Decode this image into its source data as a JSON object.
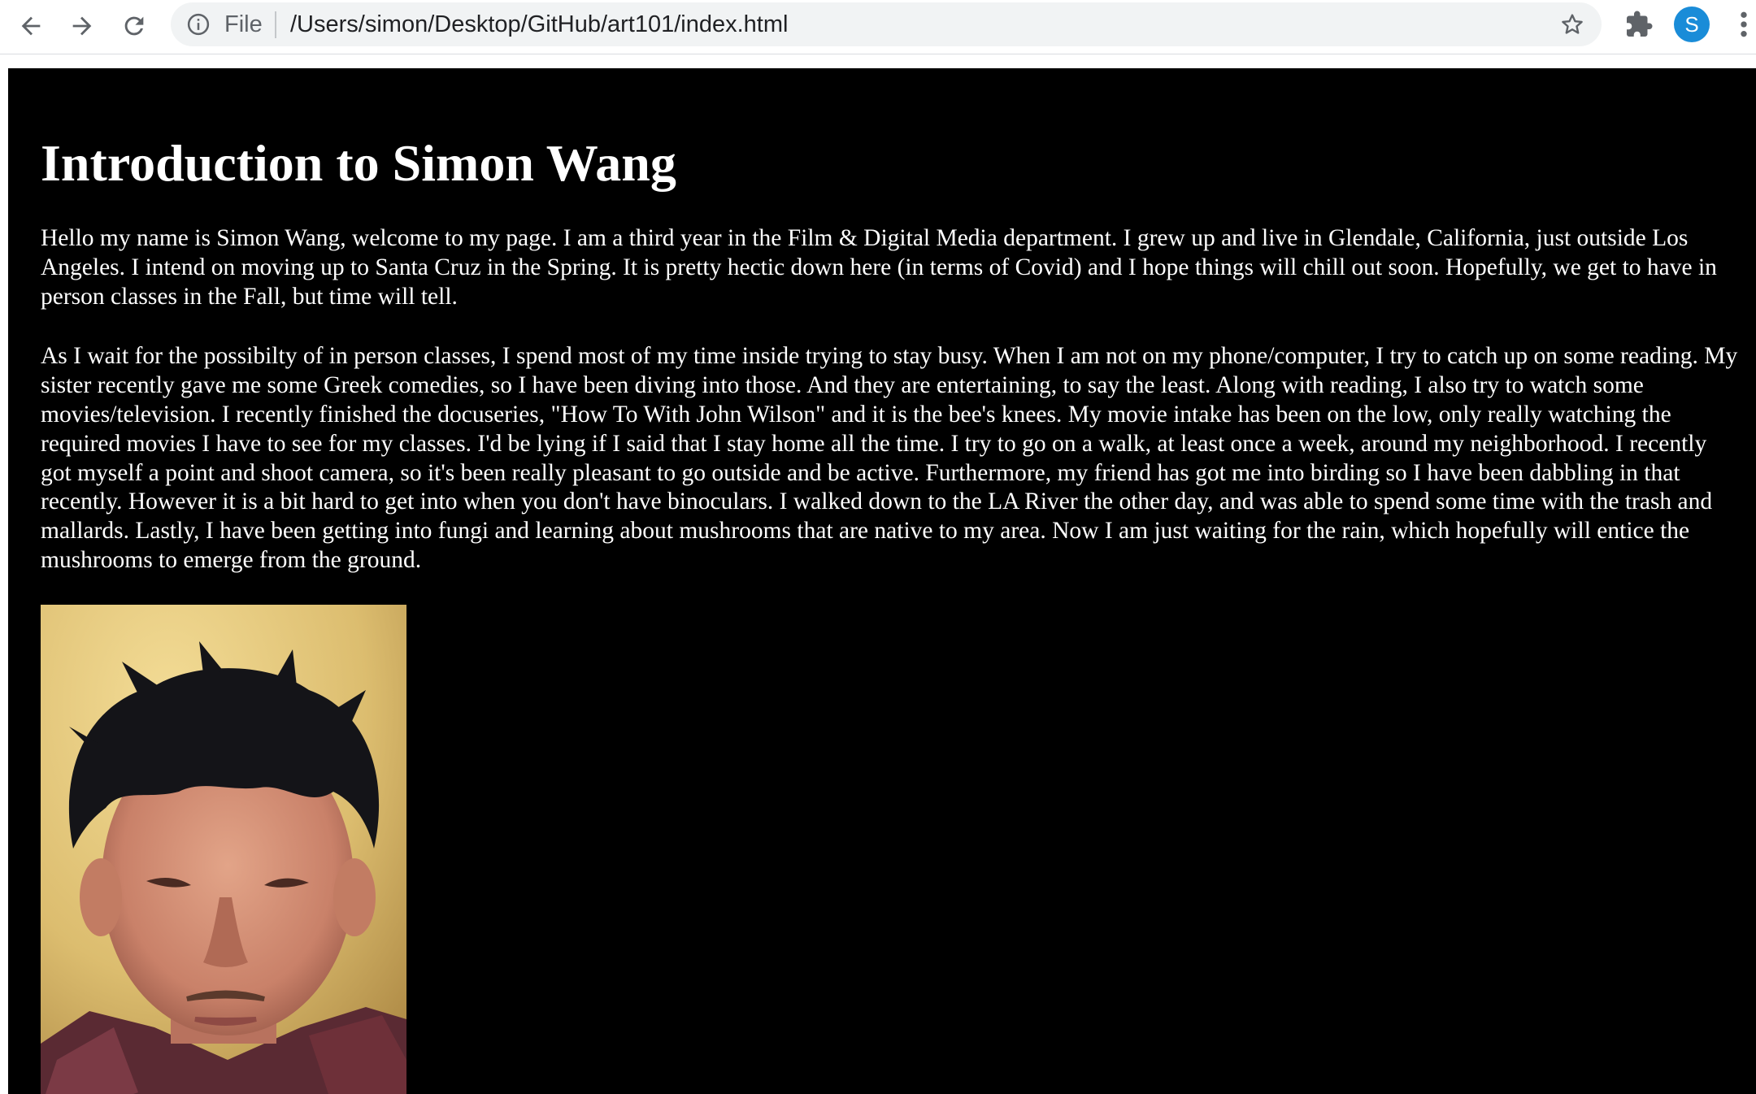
{
  "browser": {
    "scheme_label": "File",
    "url": "/Users/simon/Desktop/GitHub/art101/index.html",
    "profile_initial": "S"
  },
  "page": {
    "heading": "Introduction to Simon Wang",
    "paragraphs": [
      "Hello my name is Simon Wang, welcome to my page. I am a third year in the Film & Digital Media department. I grew up and live in Glendale, California, just outside Los Angeles. I intend on moving up to Santa Cruz in the Spring. It is pretty hectic down here (in terms of Covid) and I hope things will chill out soon. Hopefully, we get to have in person classes in the Fall, but time will tell.",
      "As I wait for the possibilty of in person classes, I spend most of my time inside trying to stay busy. When I am not on my phone/computer, I try to catch up on some reading. My sister recently gave me some Greek comedies, so I have been diving into those. And they are entertaining, to say the least. Along with reading, I also try to watch some movies/television. I recently finished the docuseries, \"How To With John Wilson\" and it is the bee's knees. My movie intake has been on the low, only really watching the required movies I have to see for my classes. I'd be lying if I said that I stay home all the time. I try to go on a walk, at least once a week, around my neighborhood. I recently got myself a point and shoot camera, so it's been really pleasant to go outside and be active. Furthermore, my friend has got me into birding so I have been dabbling in that recently. However it is a bit hard to get into when you don't have binoculars. I walked down to the LA River the other day, and was able to spend some time with the trash and mallards. Lastly, I have been getting into fungi and learning about mushrooms that are native to my area. Now I am just waiting for the rain, which hopefully will entice the mushrooms to emerge from the ground."
    ],
    "photo_icon": "portrait-photo"
  },
  "colors": {
    "page_background": "#000000",
    "page_text": "#ffffff",
    "avatar": "#1a8cd8"
  },
  "icons": {
    "back": "back-arrow-icon",
    "forward": "forward-arrow-icon",
    "reload": "reload-icon",
    "site_info": "info-icon",
    "bookmark": "star-icon",
    "extensions": "puzzle-icon",
    "menu": "kebab-menu-icon"
  }
}
